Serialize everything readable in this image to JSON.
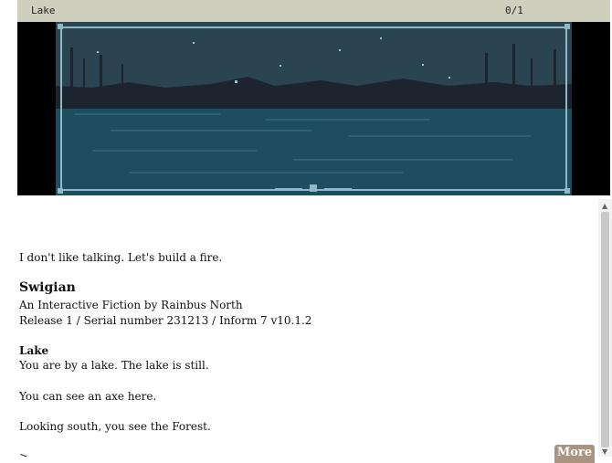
{
  "status": {
    "location": "Lake",
    "score": "0/1"
  },
  "scene": {
    "image": "pixel-art-lake-at-night",
    "colors": {
      "sky": "#2a4451",
      "water": "#1d4d5e",
      "frame": "#8fb8c6",
      "treeline": "#1c2430"
    }
  },
  "transcript": {
    "intro": "I don't like talking. Let's build a fire.",
    "game_title": "Swigian",
    "byline": "An Interactive Fiction by Rainbus North",
    "release": "Release 1 / Serial number 231213 / Inform 7 v10.1.2",
    "room_name": "Lake",
    "room_desc": "You are by a lake. The lake is still.",
    "objects": "You can see an axe here.",
    "looking": "Looking south, you see the Forest.",
    "prompt": ">"
  },
  "more_label": "More",
  "scrollbar": {
    "up_icon": "▲",
    "down_icon": "▼"
  }
}
